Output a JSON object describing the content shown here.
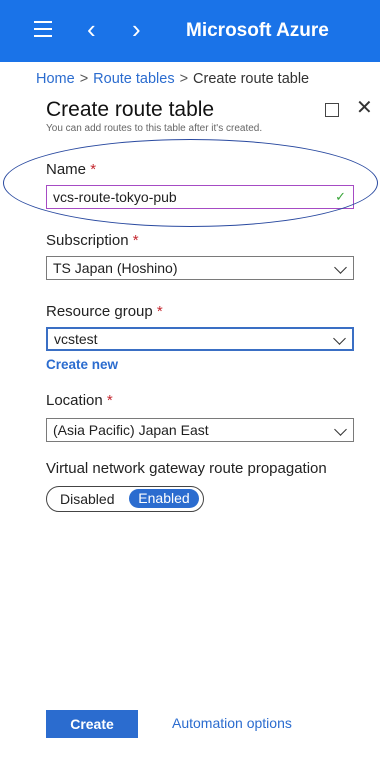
{
  "topbar": {
    "title": "Microsoft Azure"
  },
  "breadcrumb": {
    "home": "Home",
    "route_tables": "Route tables",
    "current": "Create route table",
    "separator": ">"
  },
  "panel": {
    "title": "Create route table",
    "subtitle": "You can add routes to this table after it's created."
  },
  "form": {
    "name_label": "Name",
    "name_value": "vcs-route-tokyo-pub",
    "subscription_label": "Subscription",
    "subscription_value": "TS Japan (Hoshino)",
    "resource_group_label": "Resource group",
    "resource_group_value": "vcstest",
    "create_new": "Create new",
    "location_label": "Location",
    "location_value": "(Asia Pacific) Japan East",
    "propagation_label": "Virtual network gateway route propagation",
    "toggle_off": "Disabled",
    "toggle_on": "Enabled",
    "required_mark": "*"
  },
  "footer": {
    "create": "Create",
    "automation": "Automation options"
  },
  "colors": {
    "topbar": "#1a73e8",
    "link": "#2b6ccf",
    "required": "#c4262e",
    "name_border": "#a64bc4",
    "ellipse": "#2a4aa0"
  }
}
